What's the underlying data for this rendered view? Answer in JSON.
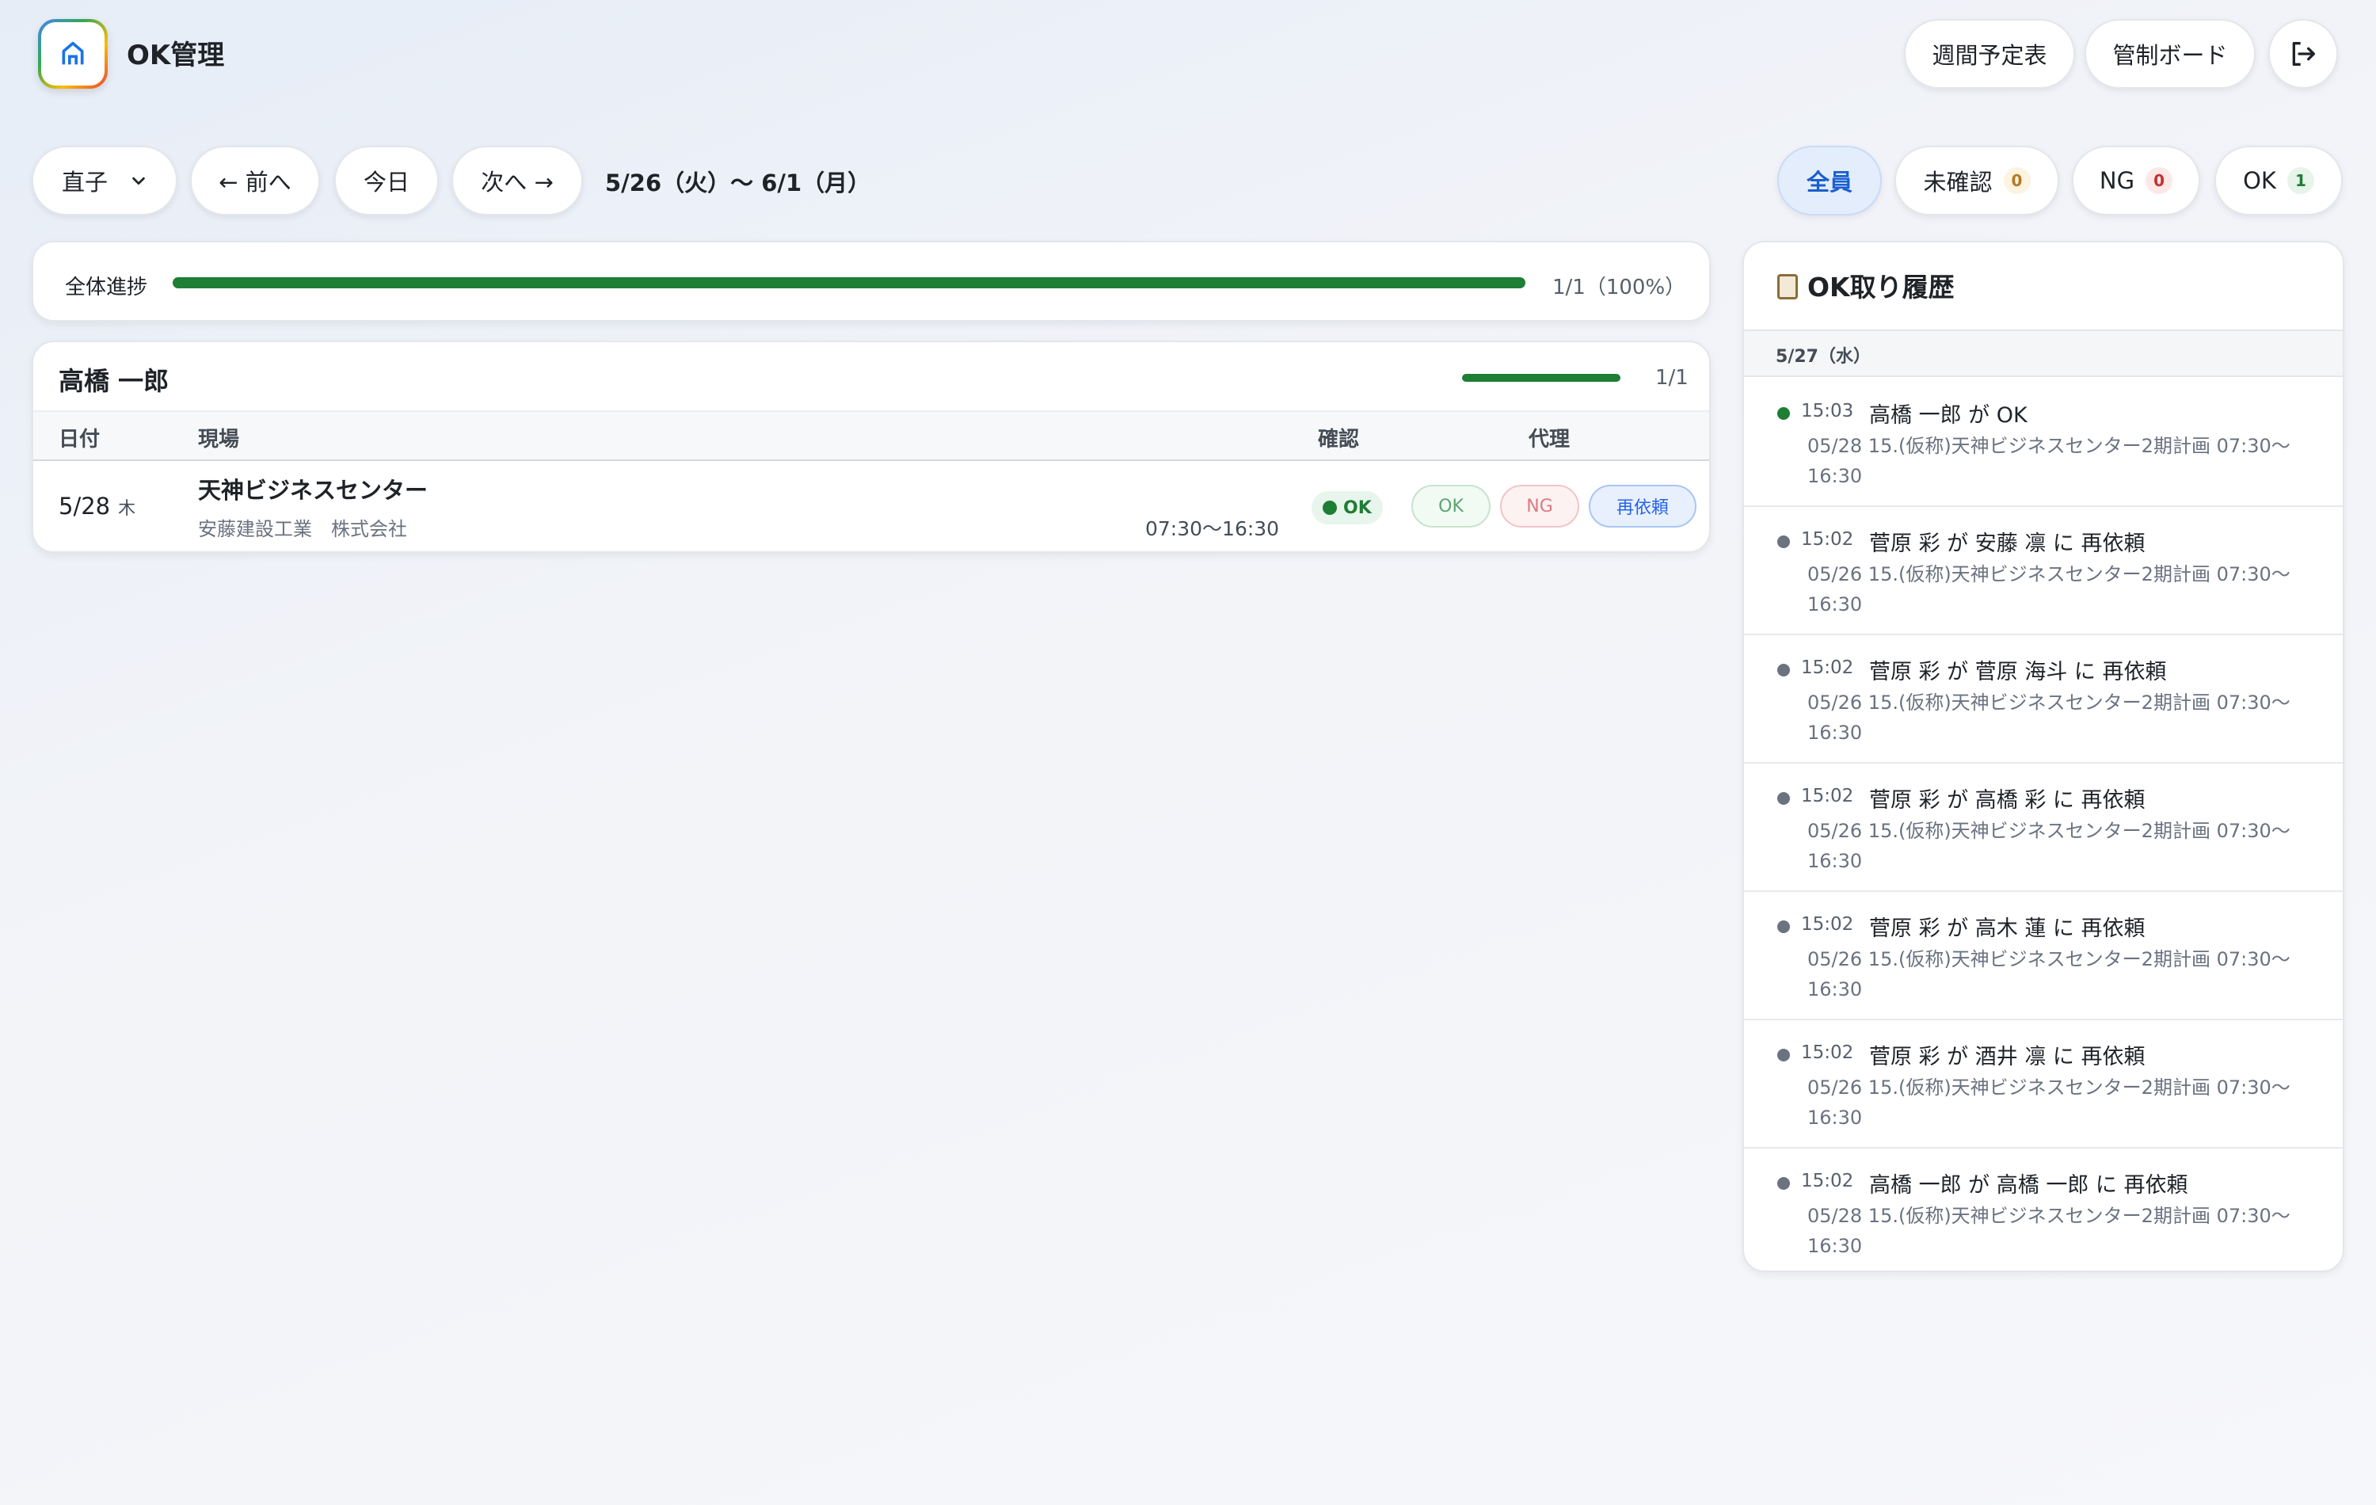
{
  "app": {
    "title": "OK管理"
  },
  "header": {
    "weekly_label": "週間予定表",
    "control_label": "管制ボード"
  },
  "toolbar": {
    "user_select": "直子",
    "prev_label": "← 前へ",
    "today_label": "今日",
    "next_label": "次へ →",
    "date_range": "5/26（火）〜 6/1（月）"
  },
  "filters": [
    {
      "label": "全員",
      "count": null,
      "active": true
    },
    {
      "label": "未確認",
      "count": "0"
    },
    {
      "label": "NG",
      "count": "0"
    },
    {
      "label": "OK",
      "count": "1"
    }
  ],
  "overall": {
    "label": "全体進捗",
    "text": "1/1（100%）",
    "progress": 1.0
  },
  "person": {
    "name": "高橋 一郎",
    "count": "1/1",
    "progress": 1.0,
    "columns": {
      "date": "日付",
      "site": "現場",
      "confirm": "確認",
      "proxy": "代理"
    },
    "rows": [
      {
        "date": "5/28",
        "weekday": "木",
        "site": "天神ビジネスセンター",
        "company": "安藤建設工業　株式会社",
        "time": "07:30〜16:30",
        "status": "OK",
        "actions": {
          "ok": "OK",
          "ng": "NG",
          "re": "再依頼"
        }
      }
    ]
  },
  "history": {
    "title": "OK取り履歴",
    "date": "5/27（水）",
    "items": [
      {
        "time": "15:03",
        "text": "高橋 一郎 が OK",
        "detail": "05/28 15.(仮称)天神ビジネスセンター2期計画 07:30〜16:30",
        "color": "#1e7e34"
      },
      {
        "time": "15:02",
        "text": "菅原 彩 が 安藤 凛 に 再依頼",
        "detail": "05/26 15.(仮称)天神ビジネスセンター2期計画 07:30〜16:30",
        "color": "#6b7280"
      },
      {
        "time": "15:02",
        "text": "菅原 彩 が 菅原 海斗 に 再依頼",
        "detail": "05/26 15.(仮称)天神ビジネスセンター2期計画 07:30〜16:30",
        "color": "#6b7280"
      },
      {
        "time": "15:02",
        "text": "菅原 彩 が 高橋 彩 に 再依頼",
        "detail": "05/26 15.(仮称)天神ビジネスセンター2期計画 07:30〜16:30",
        "color": "#6b7280"
      },
      {
        "time": "15:02",
        "text": "菅原 彩 が 高木 蓮 に 再依頼",
        "detail": "05/26 15.(仮称)天神ビジネスセンター2期計画 07:30〜16:30",
        "color": "#6b7280"
      },
      {
        "time": "15:02",
        "text": "菅原 彩 が 酒井 凛 に 再依頼",
        "detail": "05/26 15.(仮称)天神ビジネスセンター2期計画 07:30〜16:30",
        "color": "#6b7280"
      },
      {
        "time": "15:02",
        "text": "高橋 一郎 が 高橋 一郎 に 再依頼",
        "detail": "05/28 15.(仮称)天神ビジネスセンター2期計画 07:30〜16:30",
        "color": "#6b7280"
      }
    ]
  },
  "icons": {
    "logo": "home-icon",
    "logout": "logout-icon",
    "dropdown": "chevron-down-icon",
    "history": "clipboard-icon"
  }
}
